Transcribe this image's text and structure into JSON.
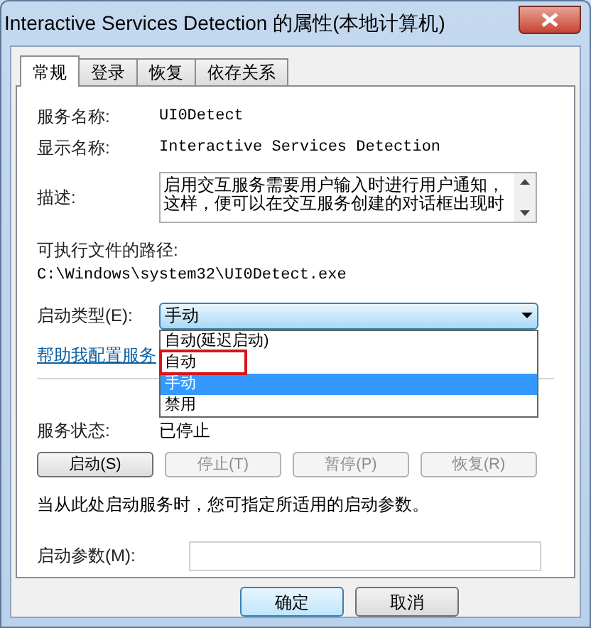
{
  "window": {
    "title": "Interactive Services Detection 的属性(本地计算机)"
  },
  "tabs": [
    {
      "label": "常规",
      "selected": true
    },
    {
      "label": "登录",
      "selected": false
    },
    {
      "label": "恢复",
      "selected": false
    },
    {
      "label": "依存关系",
      "selected": false
    }
  ],
  "service_name": {
    "label": "服务名称:",
    "value": "UI0Detect"
  },
  "display_name": {
    "label": "显示名称:",
    "value": "Interactive Services Detection"
  },
  "description": {
    "label": "描述:",
    "value": "启用交互服务需要用户输入时进行用户通知，这样，便可以在交互服务创建的对话框出现时"
  },
  "executable_path": {
    "label": "可执行文件的路径:",
    "value": "C:\\Windows\\system32\\UI0Detect.exe"
  },
  "startup_type": {
    "label": "启动类型(E):",
    "value": "手动",
    "expanded": true,
    "options": [
      {
        "label": "自动(延迟启动)",
        "selected": false
      },
      {
        "label": "自动",
        "selected": false
      },
      {
        "label": "手动",
        "selected": true
      },
      {
        "label": "禁用",
        "selected": false
      }
    ]
  },
  "help_link": "帮助我配置服务",
  "service_status": {
    "label": "服务状态:",
    "value": "已停止"
  },
  "service_buttons": [
    {
      "label": "启动(S)",
      "disabled": false
    },
    {
      "label": "停止(T)",
      "disabled": true
    },
    {
      "label": "暂停(P)",
      "disabled": true
    },
    {
      "label": "恢复(R)",
      "disabled": true
    }
  ],
  "note": "当从此处启动服务时，您可指定所适用的启动参数。",
  "start_parameters": {
    "label": "启动参数(M):"
  },
  "dialog_buttons": [
    {
      "label": "确定",
      "default": true
    },
    {
      "label": "取消",
      "default": false
    }
  ]
}
